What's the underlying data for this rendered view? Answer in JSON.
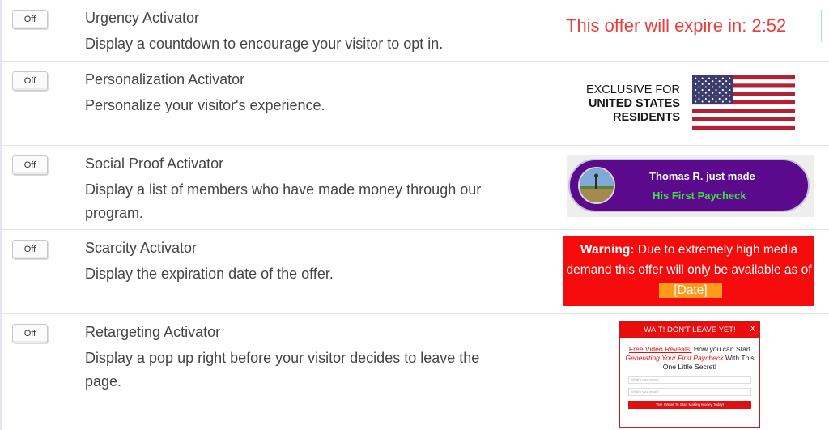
{
  "activators": [
    {
      "toggle": "Off",
      "title": "Urgency Activator",
      "desc": "Display a countdown to encourage your visitor to opt in."
    },
    {
      "toggle": "Off",
      "title": "Personalization Activator",
      "desc": "Personalize your visitor's experience."
    },
    {
      "toggle": "Off",
      "title": "Social Proof Activator",
      "desc": "Display a list of members who have made money through our program."
    },
    {
      "toggle": "Off",
      "title": "Scarcity Activator",
      "desc": "Display the expiration date of the offer."
    },
    {
      "toggle": "Off",
      "title": "Retargeting Activator",
      "desc": "Display a pop up right before your visitor decides to leave the page."
    }
  ],
  "previews": {
    "urgency": {
      "text": "This offer will expire in: 2:52"
    },
    "personalization": {
      "line1": "EXCLUSIVE FOR",
      "line2": "UNITED STATES",
      "line3": "RESIDENTS"
    },
    "social_proof": {
      "line1": "Thomas R. just made",
      "line2": "His First Paycheck"
    },
    "scarcity": {
      "warning": "Warning:",
      "text": " Due to extremely high media demand this offer will only be available as of",
      "date": "[Date]"
    },
    "retargeting": {
      "header": "WAIT! DON'T LEAVE YET!",
      "close": "X",
      "p1": "Free Video Reveals:",
      "p2": " How you can Start ",
      "p3": "Generating Your First Paycheck",
      "p4": " With This One Little Secret!",
      "name_placeholder": "What's your name?",
      "email_placeholder": "What's your email?",
      "button": "Yes! I Want To Start Making Money Today!"
    }
  },
  "colors": {
    "urgency": "#ee3b3b",
    "social_bg": "#5b0a8e",
    "social_green": "#3ce23c",
    "scarcity_bg": "#f50b0b",
    "date_chip": "#ff9a1a"
  }
}
